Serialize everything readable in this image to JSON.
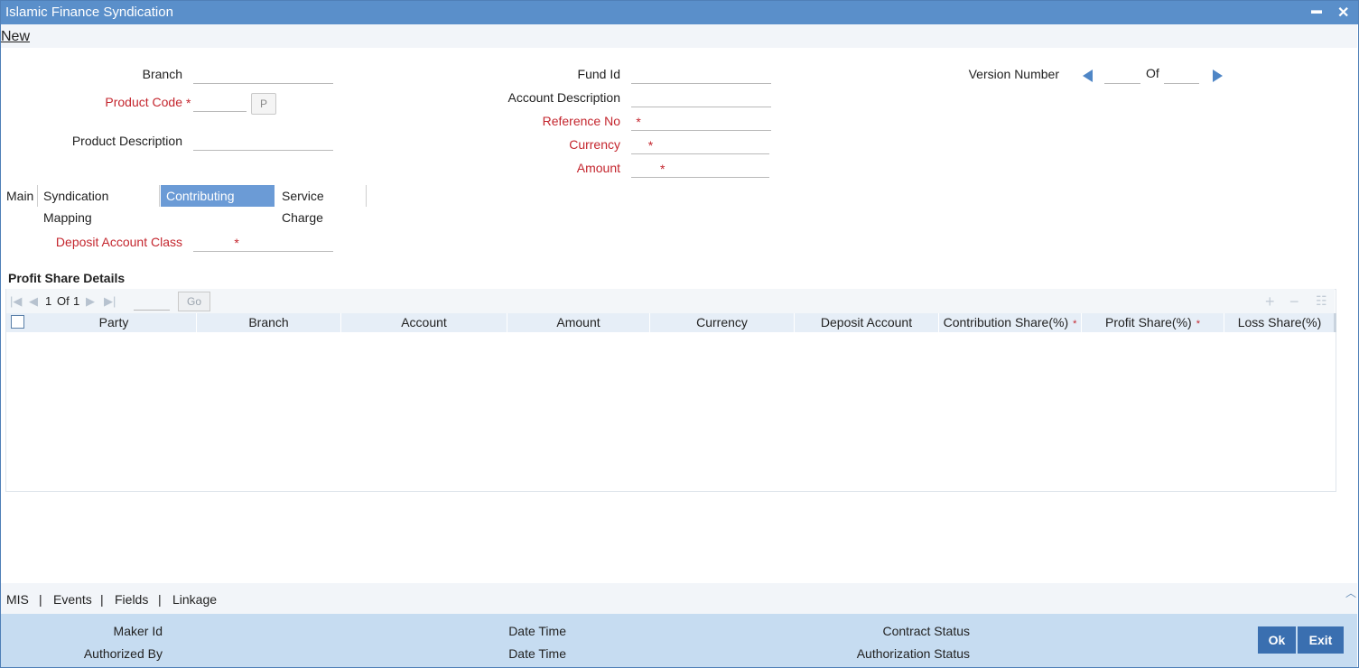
{
  "window": {
    "title": "Islamic Finance Syndication",
    "minimize": "▬",
    "close": "✕"
  },
  "menu": {
    "new": "New"
  },
  "header": {
    "branch_label": "Branch",
    "product_code_label": "Product Code",
    "product_btn": "P",
    "product_description_label": "Product Description",
    "fund_id_label": "Fund Id",
    "account_description_label": "Account Description",
    "reference_no_label": "Reference No",
    "currency_label": "Currency",
    "amount_label": "Amount",
    "version_number_label": "Version Number",
    "of_label": "Of",
    "required_mark": "*"
  },
  "tabs": [
    {
      "label": "Main"
    },
    {
      "label": "Syndication Mapping"
    },
    {
      "label": "Contributing Parties",
      "active": true
    },
    {
      "label": "Service Charge"
    }
  ],
  "contributing": {
    "deposit_account_class_label": "Deposit Account Class",
    "section_title": "Profit Share Details",
    "pagination": {
      "current": "1",
      "of": "Of",
      "total": "1",
      "go": "Go"
    },
    "toolbar_icons": [
      "add-row-icon",
      "delete-row-icon",
      "single-view-icon"
    ],
    "columns": [
      {
        "label": "Party",
        "required": false
      },
      {
        "label": "Branch",
        "required": false
      },
      {
        "label": "Account",
        "required": false
      },
      {
        "label": "Amount",
        "required": false
      },
      {
        "label": "Currency",
        "required": false
      },
      {
        "label": "Deposit Account",
        "required": false
      },
      {
        "label": "Contribution Share(%)",
        "required": true
      },
      {
        "label": "Profit Share(%)",
        "required": true
      },
      {
        "label": "Loss Share(%)",
        "required": false
      }
    ]
  },
  "bottom_links": [
    "MIS",
    "Events",
    "Fields",
    "Linkage"
  ],
  "footer": {
    "maker_id": "Maker Id",
    "authorized_by": "Authorized By",
    "date_time_1": "Date Time",
    "date_time_2": "Date Time",
    "contract_status": "Contract Status",
    "authorization_status": "Authorization Status",
    "ok": "Ok",
    "exit": "Exit"
  },
  "colors": {
    "titlebar": "#5a8fca",
    "accent": "#3a6fb0",
    "required": "#c4262e",
    "footer": "#c6dcf1"
  }
}
